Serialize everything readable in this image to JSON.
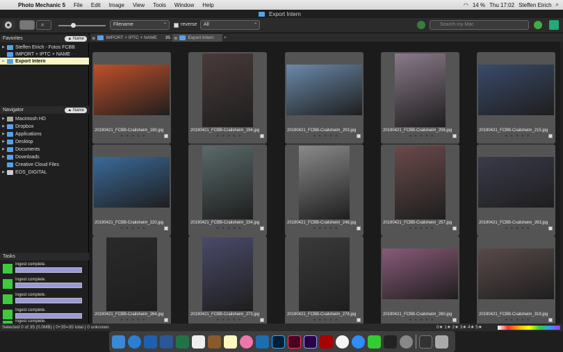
{
  "menubar": {
    "app": "Photo Mechanic 5",
    "menus": [
      "File",
      "Edit",
      "Image",
      "View",
      "Tools",
      "Window",
      "Help"
    ],
    "battery": "14 %",
    "datetime": "Thu 17:02",
    "user": "Steffen Eirich"
  },
  "window": {
    "title": "Export Intern"
  },
  "toolbar": {
    "sort": "Filename",
    "reverse": "reverse",
    "filter": "All",
    "search_placeholder": "Search my Mac"
  },
  "sidebar": {
    "favorites_title": "Favorites",
    "name_btn": "▲ Name",
    "favorites": [
      "Steffen Eirich - Fotos FCBB",
      "IMPORT + IPTC + NAME",
      "Export Intern"
    ],
    "navigator_title": "Navigator",
    "navigator": [
      "Macintosh HD",
      "Dropbox",
      "Applications",
      "Desktop",
      "Documents",
      "Downloads",
      "Creative Cloud Files",
      "EOS_DIGITAL"
    ],
    "tasks_title": "Tasks",
    "tasks": [
      "Ingest complete.",
      "Ingest complete.",
      "Ingest complete.",
      "Ingest complete.",
      "Ingest complete."
    ]
  },
  "tabs": [
    {
      "label": "IMPORT + IPTC + NAME",
      "count": "35"
    },
    {
      "label": "Export Intern"
    }
  ],
  "rows": [
    [
      "20190421_FCBB-Crailsheim_180.jpg",
      "20190421_FCBB-Crailsheim_194.jpg",
      "20190421_FCBB-Crailsheim_203.jpg",
      "20190421_FCBB-Crailsheim_208.jpg",
      "20190421_FCBB-Crailsheim_215.jpg"
    ],
    [
      "20190421_FCBB-Crailsheim_220.jpg",
      "20190421_FCBB-Crailsheim_234.jpg",
      "20190421_FCBB-Crailsheim_248.jpg",
      "20190421_FCBB-Crailsheim_257.jpg",
      "20190421_FCBB-Crailsheim_263.jpg"
    ],
    [
      "20190421_FCBB-Crailsheim_264.jpg",
      "20190421_FCBB-Crailsheim_273.jpg",
      "20190421_FCBB-Crailsheim_278.jpg",
      "20190421_FCBB-Crailsheim_280.jpg",
      "20190421_FCBB-Crailsheim_319.jpg"
    ]
  ],
  "status": "Selected 0 of 35 (0.0MB) | 0+35=35 total | 0 unknown",
  "stars": "★ ★ ★ ★ ★",
  "ratings": "0★ 1★ 2★ 3★ 4★ 5★"
}
